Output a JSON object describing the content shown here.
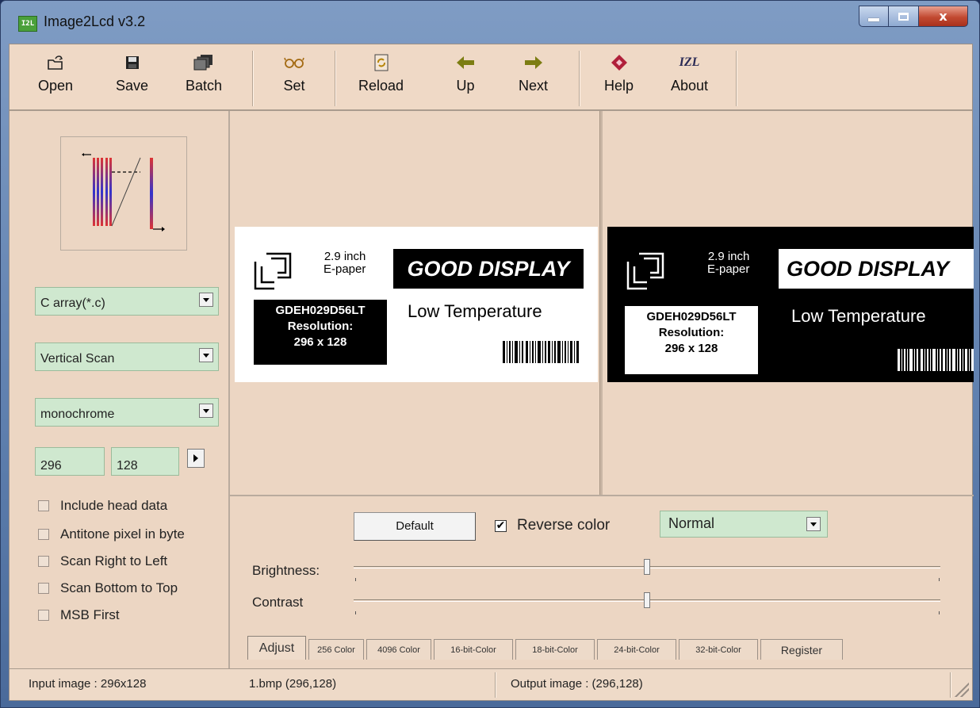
{
  "window": {
    "title": "Image2Lcd v3.2",
    "icon_text": "I2L",
    "minimize_icon": "minimize-icon",
    "maximize_icon": "maximize-icon",
    "close_icon": "close-icon",
    "close_glyph": "x"
  },
  "toolbar": {
    "buttons": [
      {
        "label": "Open",
        "icon": "open-folder-icon"
      },
      {
        "label": "Save",
        "icon": "floppy-disk-icon"
      },
      {
        "label": "Batch",
        "icon": "batch-files-icon"
      },
      {
        "label": "Set",
        "icon": "glasses-icon"
      },
      {
        "label": "Reload",
        "icon": "reload-icon"
      },
      {
        "label": "Up",
        "icon": "arrow-left-icon"
      },
      {
        "label": "Next",
        "icon": "arrow-right-icon"
      },
      {
        "label": "Help",
        "icon": "help-book-icon"
      },
      {
        "label": "About",
        "icon": "izl-logo-icon",
        "icon_text": "IZL"
      }
    ]
  },
  "left_panel": {
    "output_type": "C array(*.c)",
    "scan_mode": "Vertical Scan",
    "color_depth": "monochrome",
    "width": "296",
    "height": "128",
    "options": [
      {
        "label": "Include head data",
        "checked": false
      },
      {
        "label": "Antitone pixel in byte",
        "checked": false
      },
      {
        "label": "Scan Right to Left",
        "checked": false
      },
      {
        "label": "Scan Bottom to Top",
        "checked": false
      },
      {
        "label": "MSB First",
        "checked": false
      }
    ]
  },
  "epaper": {
    "size_line1": "2.9 inch",
    "size_line2": "E-paper",
    "brand": "GOOD DISPLAY",
    "model": "GDEH029D56LT",
    "resolution_label": "Resolution:",
    "resolution_value": "296 x 128",
    "temperature": "Low Temperature"
  },
  "adjust": {
    "default_label": "Default",
    "reverse_color_label": "Reverse color",
    "reverse_color_checked": true,
    "check_glyph": "✔",
    "mode": "Normal",
    "brightness_label": "Brightness:",
    "brightness_value": 0.5,
    "contrast_label": "Contrast",
    "contrast_value": 0.5
  },
  "tabs": [
    {
      "label": "Adjust",
      "active": true
    },
    {
      "label": "256 Color",
      "active": false
    },
    {
      "label": "4096 Color",
      "active": false
    },
    {
      "label": "16-bit-Color",
      "active": false
    },
    {
      "label": "18-bit-Color",
      "active": false
    },
    {
      "label": "24-bit-Color",
      "active": false
    },
    {
      "label": "32-bit-Color",
      "active": false
    },
    {
      "label": "Register",
      "active": false
    }
  ],
  "status": {
    "input_image": "Input image : 296x128",
    "file": "1.bmp (296,128)",
    "output_image": "Output image : (296,128)"
  }
}
